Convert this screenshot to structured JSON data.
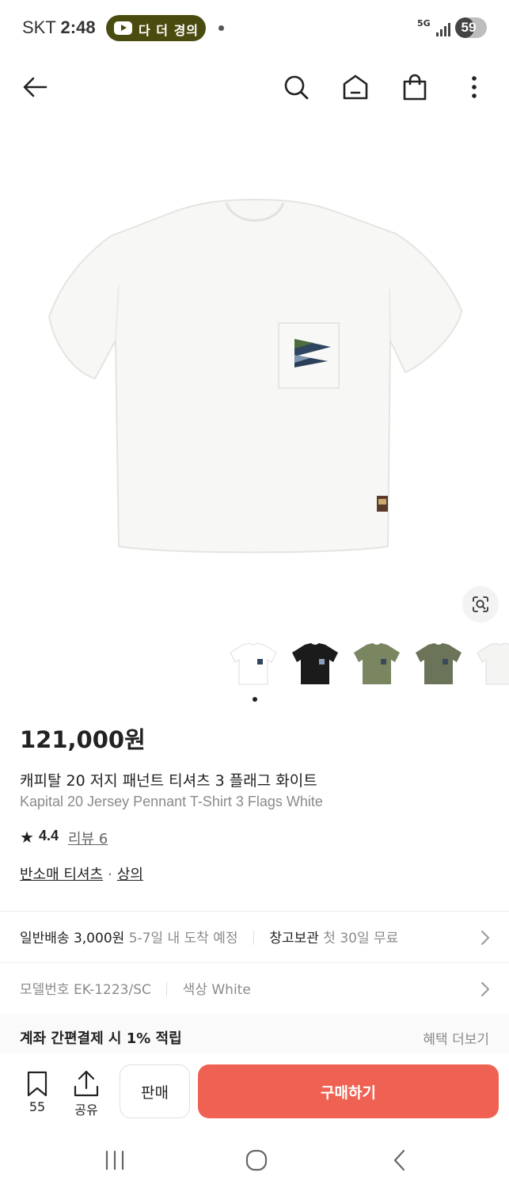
{
  "status_bar": {
    "carrier": "SKT",
    "time": "2:48",
    "media_pill_text": "다 더 경의",
    "network": "5G",
    "battery": "59",
    "battery_level": 0.59
  },
  "nav_bar": {
    "icons": [
      "back-arrow-icon",
      "search-icon",
      "home-icon",
      "shopping-bag-icon",
      "more-vertical-icon"
    ]
  },
  "product": {
    "price": "121,000원",
    "name_ko": "캐피탈 20 저지 패넌트 티셔츠 3 플래그 화이트",
    "name_en": "Kapital 20 Jersey Pennant T-Shirt 3 Flags White",
    "rating": "4.4",
    "review_link": "리뷰 6",
    "category_1": "반소매 티셔츠",
    "category_separator": "·",
    "category_2": "상의",
    "thumbnail_colors": [
      "#ffffff",
      "#1b1b1b",
      "#7a8660",
      "#6b7458",
      "#f4f4f2"
    ]
  },
  "delivery": {
    "title": "일반배송 3,000원",
    "eta": "5-7일 내 도착 예정",
    "storage_title": "창고보관",
    "storage_info": "첫 30일 무료"
  },
  "details": {
    "model": "모델번호 EK-1223/SC",
    "color": "색상 White"
  },
  "benefit": {
    "title": "계좌 간편결제 시 1% 적립",
    "more": "혜택 더보기"
  },
  "action_bar": {
    "bookmark_count": "55",
    "share_label": "공유",
    "sell_label": "판매",
    "buy_label": "구매하기"
  },
  "colors": {
    "accent": "#ef6253",
    "text": "#222222",
    "muted": "#8a8a8a"
  }
}
